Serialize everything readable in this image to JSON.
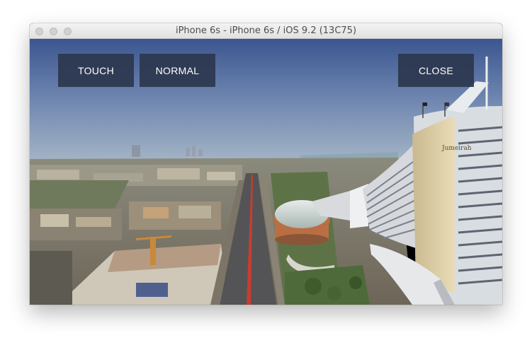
{
  "window": {
    "title": "iPhone 6s - iPhone 6s / iOS 9.2 (13C75)"
  },
  "controls": {
    "touch_label": "TOUCH",
    "normal_label": "NORMAL",
    "close_label": "CLOSE"
  },
  "scene": {
    "hotel_sign": "Jumeirah"
  },
  "colors": {
    "button_bg": "#2c374e",
    "button_text": "#ffffff",
    "sky_top": "#3d5690",
    "sky_horizon": "#a9b9c8"
  }
}
